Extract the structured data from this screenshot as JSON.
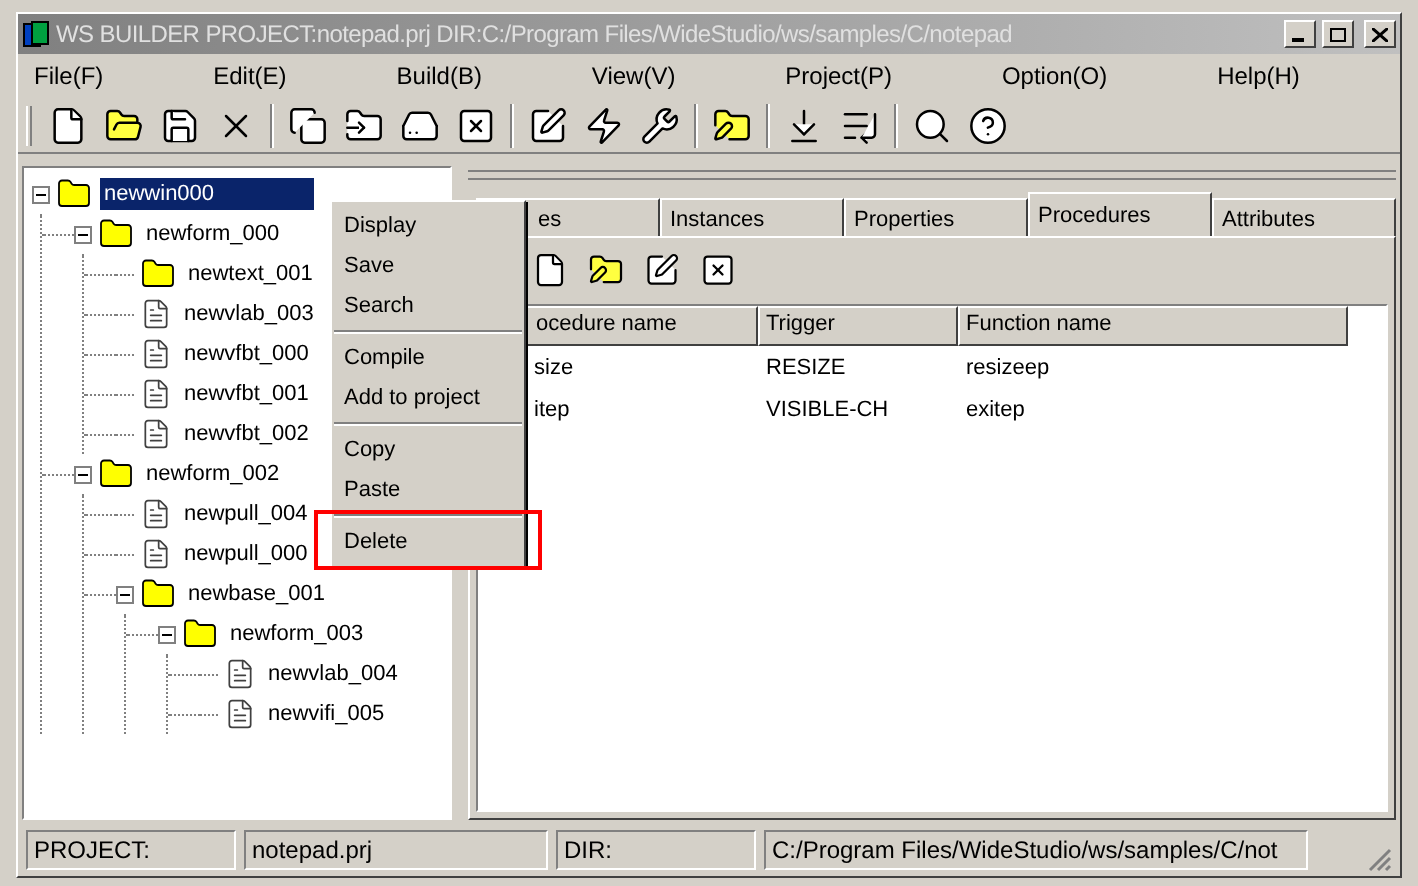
{
  "window": {
    "title": "WS BUILDER PROJECT:notepad.prj DIR:C:/Program Files/WideStudio/ws/samples/C/notepad"
  },
  "menu_bar": [
    "File(F)",
    "Edit(E)",
    "Build(B)",
    "View(V)",
    "Project(P)",
    "Option(O)",
    "Help(H)"
  ],
  "tree": {
    "label": "newwin000",
    "kind": "folder",
    "selected": true,
    "expanded": true,
    "children": [
      {
        "label": "newform_000",
        "kind": "folder",
        "selected": false,
        "expanded": true,
        "children": [
          {
            "label": "newtext_001",
            "kind": "folder",
            "selected": false
          },
          {
            "label": "newvlab_003",
            "kind": "document",
            "selected": false
          },
          {
            "label": "newvfbt_000",
            "kind": "document",
            "selected": false
          },
          {
            "label": "newvfbt_001",
            "kind": "document",
            "selected": false
          },
          {
            "label": "newvfbt_002",
            "kind": "document",
            "selected": false
          }
        ]
      },
      {
        "label": "newform_002",
        "kind": "folder",
        "selected": false,
        "expanded": true,
        "children": [
          {
            "label": "newpull_004",
            "kind": "document",
            "selected": false
          },
          {
            "label": "newpull_000",
            "kind": "document",
            "selected": false
          },
          {
            "label": "newbase_001",
            "kind": "folder",
            "selected": false,
            "expanded": true,
            "children": [
              {
                "label": "newform_003",
                "kind": "folder",
                "selected": false,
                "expanded": true,
                "children": [
                  {
                    "label": "newvlab_004",
                    "kind": "document",
                    "selected": false
                  },
                  {
                    "label": "newvifi_005",
                    "kind": "document",
                    "selected": false
                  }
                ]
              }
            ]
          }
        ]
      }
    ]
  },
  "context_menu": {
    "groups": [
      [
        {
          "label": "Display",
          "marked": false
        },
        {
          "label": "Save",
          "marked": false
        },
        {
          "label": "Search",
          "marked": false
        }
      ],
      [
        {
          "label": "Compile",
          "marked": false
        },
        {
          "label": "Add to project",
          "marked": false
        }
      ],
      [
        {
          "label": "Copy",
          "marked": false
        },
        {
          "label": "Paste",
          "marked": false
        }
      ],
      [
        {
          "label": "Delete",
          "marked": true
        }
      ]
    ]
  },
  "tabs": [
    {
      "label": "es",
      "selected": false
    },
    {
      "label": "Instances",
      "selected": false
    },
    {
      "label": "Properties",
      "selected": false
    },
    {
      "label": "Procedures",
      "selected": true
    },
    {
      "label": "Attributes",
      "selected": false
    }
  ],
  "procedures": {
    "columns": [
      "ocedure name",
      "Trigger",
      "Function name"
    ],
    "rows": [
      [
        "size",
        "RESIZE",
        "resizeep"
      ],
      [
        "itep",
        "VISIBLE-CH",
        "exitep"
      ]
    ]
  },
  "status_bar": [
    "PROJECT:",
    "notepad.prj",
    "DIR:",
    "C:/Program Files/WideStudio/ws/samples/C/not"
  ]
}
